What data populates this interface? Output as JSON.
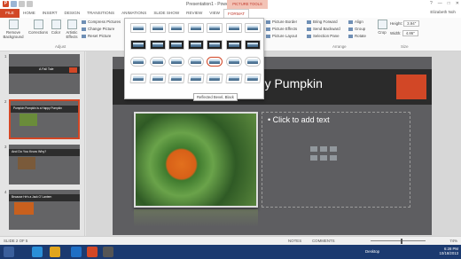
{
  "window": {
    "title": "Presentation1 - PowerPoint",
    "context_tab_group": "PICTURE TOOLS",
    "controls": [
      "?",
      "—",
      "□",
      "✕"
    ],
    "user": "Elizabeth Noh"
  },
  "tabs": [
    {
      "label": "FILE"
    },
    {
      "label": "HOME"
    },
    {
      "label": "INSERT"
    },
    {
      "label": "DESIGN"
    },
    {
      "label": "TRANSITIONS"
    },
    {
      "label": "ANIMATIONS"
    },
    {
      "label": "SLIDE SHOW"
    },
    {
      "label": "REVIEW"
    },
    {
      "label": "VIEW"
    },
    {
      "label": "FORMAT"
    }
  ],
  "ribbon": {
    "remove_bg": "Remove Background",
    "corrections": "Corrections",
    "color": "Color",
    "artistic": "Artistic Effects",
    "compress": "Compress Pictures",
    "change": "Change Picture",
    "reset": "Reset Picture",
    "adjust_group": "Adjust",
    "picture_border": "Picture Border",
    "picture_effects": "Picture Effects",
    "picture_layout": "Picture Layout",
    "bring_forward": "Bring Forward",
    "send_backward": "Send Backward",
    "selection_pane": "Selection Pane",
    "align": "Align",
    "group": "Group",
    "rotate": "Rotate",
    "arrange_group": "Arrange",
    "crop": "Crop",
    "height_label": "Height:",
    "height_value": "3.94\"",
    "width_label": "Width:",
    "width_value": "4.86\"",
    "size_group": "Size"
  },
  "gallery": {
    "tooltip": "Reflected Bevel, Black",
    "hovered_index": 18
  },
  "thumbnails": [
    {
      "num": "1",
      "text": "A Fall Tale"
    },
    {
      "num": "2",
      "text": "Pumpkin Pumpkin is a Happy Pumpkin"
    },
    {
      "num": "3",
      "text": "And Do You Know Why?"
    },
    {
      "num": "4",
      "text": "Because He's a Jack O' Lantern"
    }
  ],
  "slide": {
    "title": "ppy Pumpkin",
    "content_placeholder": "• Click to add text"
  },
  "status": {
    "slide_count": "SLIDE 2 OF 5",
    "notes": "NOTES",
    "comments": "COMMENTS",
    "zoom": "74%"
  },
  "taskbar": {
    "desktop": "Desktop",
    "time": "6:28 PM",
    "date": "10/18/2013"
  },
  "colors": {
    "accent": "#d24726",
    "taskbar": "#1b3a70",
    "slide_bg": "#5e5e61"
  }
}
